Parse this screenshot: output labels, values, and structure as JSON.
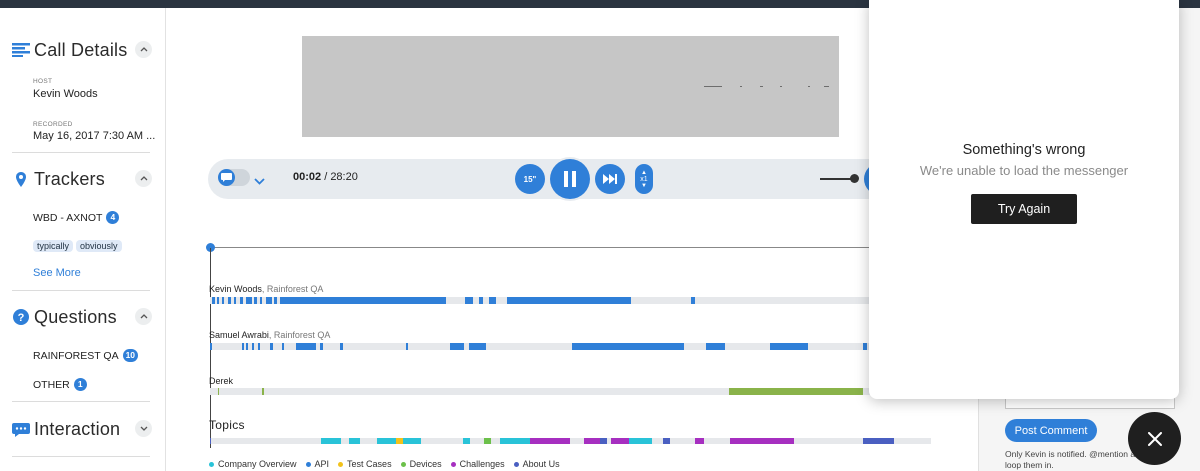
{
  "sidebar": {
    "call_details": {
      "title": "Call Details",
      "host_label": "HOST",
      "host": "Kevin Woods",
      "recorded_label": "RECORDED",
      "recorded": "May 16, 2017 7:30 AM ..."
    },
    "trackers": {
      "title": "Trackers",
      "tracker_name": "WBD - AXNOT",
      "tracker_count": "4",
      "chips": [
        "typically",
        "obviously"
      ],
      "see_more": "See More"
    },
    "questions": {
      "title": "Questions",
      "items": [
        {
          "label": "RAINFOREST QA",
          "count": "10"
        },
        {
          "label": "OTHER",
          "count": "1"
        }
      ]
    },
    "interaction": {
      "title": "Interaction"
    }
  },
  "player": {
    "current_time": "00:02",
    "total_time": "28:20",
    "skip_back_label": "15\"",
    "speed_label": "x1"
  },
  "speakers": [
    {
      "name": "Kevin Woods",
      "company": ", Rainforest QA"
    },
    {
      "name": "Samuel Awrabi",
      "company": ", Rainforest QA"
    },
    {
      "name": "Derek",
      "company": ""
    }
  ],
  "topics": {
    "label": "Topics",
    "legend": [
      {
        "name": "Company Overview",
        "color": "#29c3d8"
      },
      {
        "name": "API",
        "color": "#2f7fd8"
      },
      {
        "name": "Test Cases",
        "color": "#f2c21b"
      },
      {
        "name": "Devices",
        "color": "#6cc04a"
      },
      {
        "name": "Challenges",
        "color": "#a62fc0"
      },
      {
        "name": "About Us",
        "color": "#4a5fc1"
      }
    ]
  },
  "comments": {
    "post_button": "Post Comment",
    "notice": "Only Kevin is notified. @mention a user to loop them in."
  },
  "messenger": {
    "title": "Something's wrong",
    "subtitle": "We're unable to load the messenger",
    "retry": "Try Again"
  },
  "colors": {
    "accent": "#2f7fd8",
    "derek_track": "#8ab34a"
  }
}
